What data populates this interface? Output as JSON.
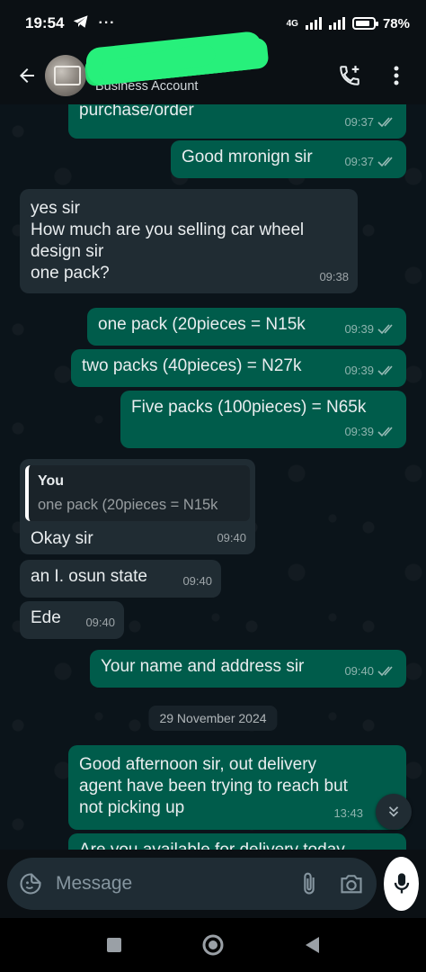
{
  "status_bar": {
    "time": "19:54",
    "dots": "···",
    "network": "4G",
    "battery": "78%"
  },
  "header": {
    "contact_name": "",
    "subtitle": "Business Account"
  },
  "messages": [
    {
      "dir": "out",
      "text": "purchase/order",
      "time": "09:37"
    },
    {
      "dir": "out",
      "text": "Good mronign sir",
      "time": "09:37"
    },
    {
      "dir": "in",
      "lines": [
        "yes sir",
        "How much are you selling car wheel",
        "design sir",
        "one pack?"
      ],
      "time": "09:38"
    },
    {
      "dir": "out",
      "text": "one pack (20pieces = N15k",
      "time": "09:39"
    },
    {
      "dir": "out",
      "text": "two packs (40pieces) = N27k",
      "time": "09:39"
    },
    {
      "dir": "out",
      "text": "Five packs (100pieces) = N65k",
      "time": "09:39"
    },
    {
      "dir": "in",
      "quote_author": "You",
      "quote_text": "one pack (20pieces = N15k",
      "text": "Okay sir",
      "time": "09:40"
    },
    {
      "dir": "in",
      "text": "an I. osun state",
      "time": "09:40"
    },
    {
      "dir": "in",
      "text": "Ede",
      "time": "09:40"
    },
    {
      "dir": "out",
      "text": "Your name and address sir",
      "time": "09:40"
    },
    {
      "dir": "out",
      "lines": [
        "Good afternoon sir, out delivery",
        "agent have been trying to reach but",
        "not picking up"
      ],
      "time": "13:43"
    },
    {
      "dir": "out",
      "text": "Are you available for delivery today"
    }
  ],
  "date_separator": "29 November 2024",
  "composer": {
    "placeholder": "Message"
  },
  "icons": {
    "back": "arrow-left-icon",
    "call": "add-call-icon",
    "menu": "more-vert-icon",
    "emoji": "sticker-icon",
    "attach": "paperclip-icon",
    "camera": "camera-icon",
    "mic": "microphone-icon",
    "scroll": "chevron-double-down-icon"
  },
  "colors": {
    "outgoing_bubble": "#005c4b",
    "incoming_bubble": "#202c33",
    "chat_background": "#0b141a",
    "redaction": "#27f07b"
  }
}
